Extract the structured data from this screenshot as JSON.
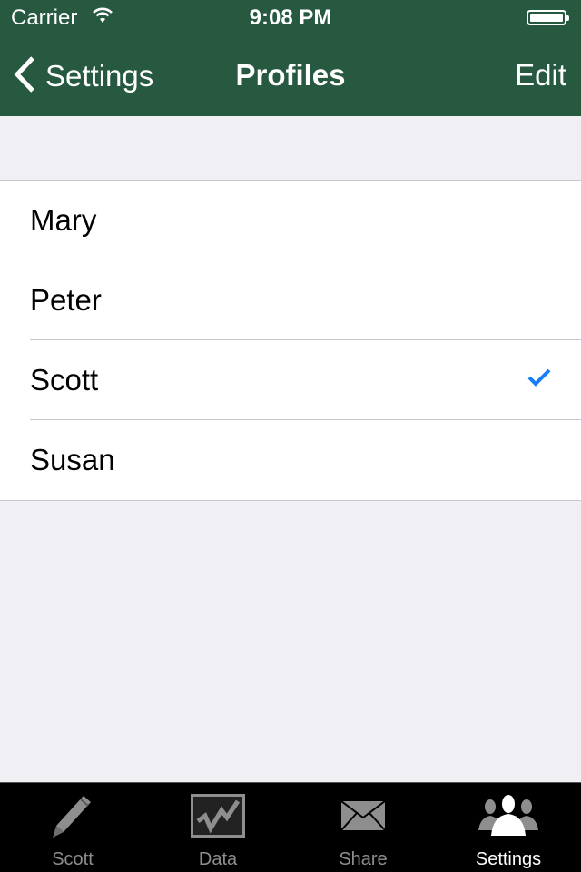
{
  "status_bar": {
    "carrier": "Carrier",
    "time": "9:08 PM",
    "battery_level": 1.0
  },
  "nav": {
    "back_label": "Settings",
    "title": "Profiles",
    "edit_label": "Edit",
    "bar_color": "#275941"
  },
  "profiles": [
    {
      "name": "Mary",
      "selected": false
    },
    {
      "name": "Peter",
      "selected": false
    },
    {
      "name": "Scott",
      "selected": true
    },
    {
      "name": "Susan",
      "selected": false
    }
  ],
  "checkmark_color": "#157efb",
  "tabs": [
    {
      "label": "Scott",
      "icon": "pencil-icon",
      "active": false
    },
    {
      "label": "Data",
      "icon": "chart-icon",
      "active": false
    },
    {
      "label": "Share",
      "icon": "envelope-icon",
      "active": false
    },
    {
      "label": "Settings",
      "icon": "people-icon",
      "active": true
    }
  ]
}
